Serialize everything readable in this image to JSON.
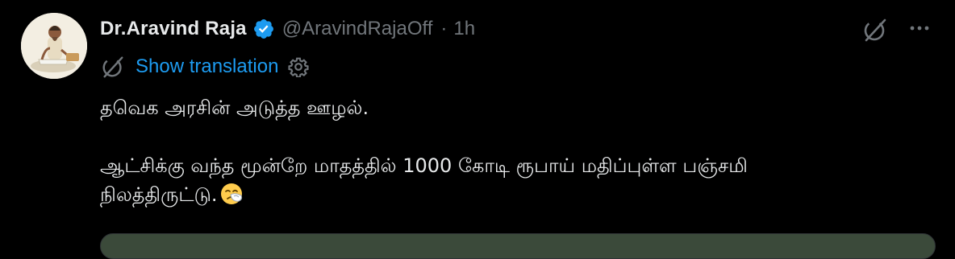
{
  "tweet": {
    "display_name": "Dr.Aravind Raja",
    "handle": "@AravindRajaOff",
    "separator": "·",
    "time": "1h",
    "show_translation": "Show translation",
    "text_line1": "தவெக அரசின் அடுத்த ஊழல்.",
    "text_line2": "ஆட்சிக்கு வந்த மூன்றே மாதத்தில் 1000 கோடி ரூபாய் மதிப்புள்ள பஞ்சமி",
    "text_line3": "நிலத்திருட்டு.",
    "emoji": "sneezing-face-icon"
  },
  "colors": {
    "background": "#000000",
    "text": "#e7e9ea",
    "muted": "#71767b",
    "link": "#1d9bf0",
    "verified": "#1d9bf0"
  }
}
